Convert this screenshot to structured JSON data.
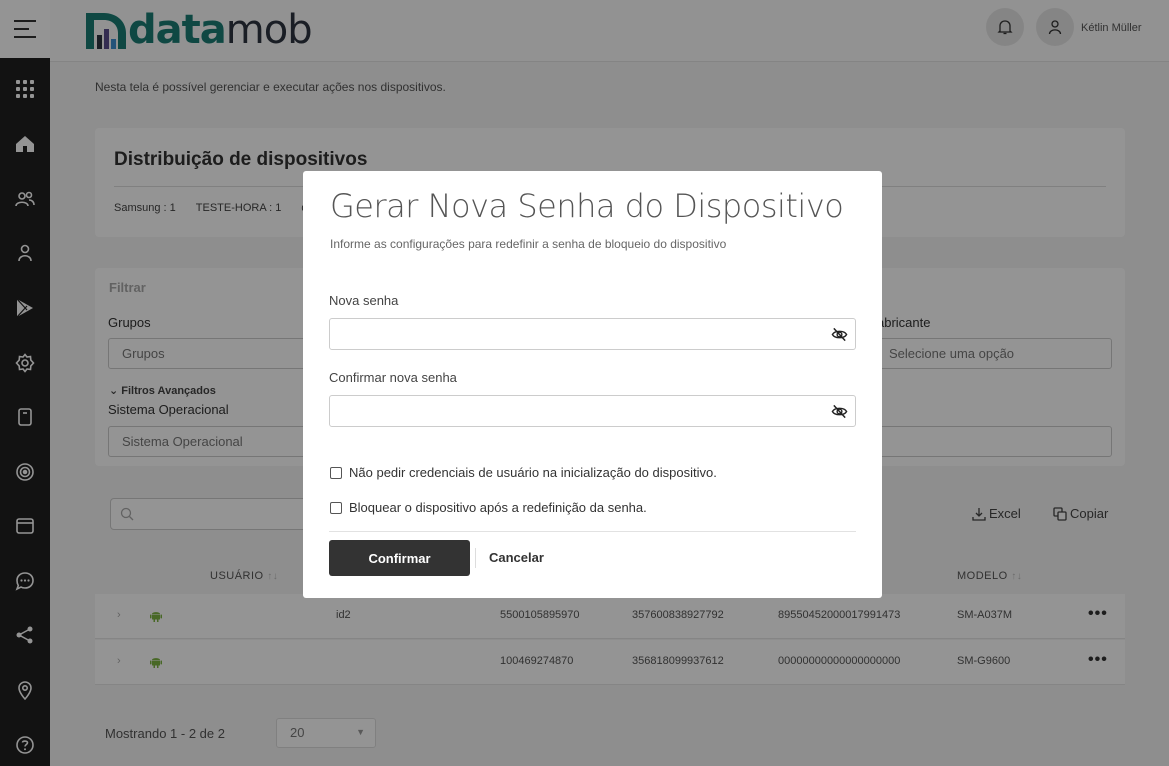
{
  "brand": {
    "logo_bold": "data",
    "logo_light": "mob"
  },
  "header": {
    "user_name": "Kétlin Müller",
    "notification_icon": "bell-icon",
    "user_icon": "user-icon"
  },
  "sidebar": {
    "items": [
      {
        "icon": "apps-grid-icon"
      },
      {
        "icon": "home-icon"
      },
      {
        "icon": "users-icon"
      },
      {
        "icon": "user-icon"
      },
      {
        "icon": "play-store-icon"
      },
      {
        "icon": "settings-icon"
      },
      {
        "icon": "device-icon"
      },
      {
        "icon": "fingerprint-icon"
      },
      {
        "icon": "window-icon"
      },
      {
        "icon": "chat-icon"
      },
      {
        "icon": "share-icon"
      },
      {
        "icon": "location-icon"
      },
      {
        "icon": "help-icon"
      }
    ]
  },
  "page": {
    "description": "Nesta tela é possível gerenciar e executar ações nos dispositivos."
  },
  "distribution": {
    "title": "Distribuição de dispositivos",
    "items": [
      "Samsung : 1",
      "TESTE-HORA : 1",
      "d"
    ]
  },
  "filters": {
    "title": "Filtrar",
    "groups_label": "Grupos",
    "groups_placeholder": "Grupos",
    "manufacturer_label": "abricante",
    "manufacturer_placeholder": "Selecione uma opção",
    "advanced_label": "Filtros Avançados",
    "os_label": "Sistema Operacional",
    "os_placeholder": "Sistema Operacional"
  },
  "actions": {
    "excel": "Excel",
    "copy": "Copiar"
  },
  "table": {
    "headers": {
      "user": "USUÁRIO",
      "model": "MODELO"
    },
    "rows": [
      {
        "user": "id2",
        "phone": "5500105895970",
        "imei": "357600838927792",
        "iccid": "89550452000017991473",
        "model": "SM-A037M"
      },
      {
        "user": "",
        "phone": "100469274870",
        "imei": "356818099937612",
        "iccid": "00000000000000000000",
        "model": "SM-G9600"
      }
    ]
  },
  "pagination": {
    "text": "Mostrando 1 - 2 de 2",
    "page_size": "20"
  },
  "modal": {
    "title": "Gerar Nova Senha do Dispositivo",
    "subtitle": "Informe as configurações para redefinir a senha de bloqueio do dispositivo",
    "new_password_label": "Nova senha",
    "confirm_password_label": "Confirmar nova senha",
    "new_password_value": "",
    "confirm_password_value": "",
    "checkbox_1": "Não pedir credenciais de usuário na inicialização do dispositivo.",
    "checkbox_2": "Bloquear o dispositivo após a redefinição da senha.",
    "checkbox_1_checked": false,
    "checkbox_2_checked": false,
    "confirm_button": "Confirmar",
    "cancel_button": "Cancelar"
  }
}
